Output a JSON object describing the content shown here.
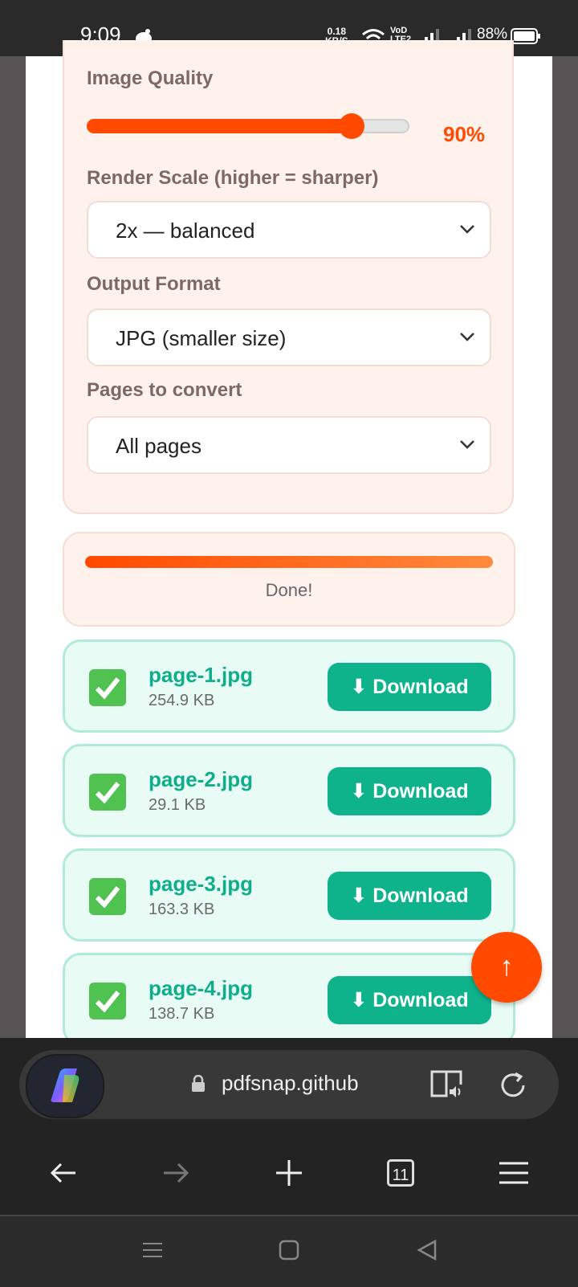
{
  "status": {
    "time": "9:09",
    "net_speed_value": "0.18",
    "net_speed_unit": "KB/S",
    "volte_top": "VoD",
    "volte_bottom": "LTE2",
    "battery": "88%"
  },
  "settings": {
    "quality_label": "Image Quality",
    "quality_value": "90%",
    "quality_fraction": 0.82,
    "scale_label": "Render Scale (higher = sharper)",
    "scale_selected": "2x — balanced",
    "format_label": "Output Format",
    "format_selected": "JPG (smaller size)",
    "pages_label": "Pages to convert",
    "pages_selected": "All pages"
  },
  "progress": {
    "status": "Done!",
    "fraction": 1.0
  },
  "files": [
    {
      "name": "page-1.jpg",
      "size": "254.9 KB",
      "button": "⬇ Download"
    },
    {
      "name": "page-2.jpg",
      "size": "29.1 KB",
      "button": "⬇ Download"
    },
    {
      "name": "page-3.jpg",
      "size": "163.3 KB",
      "button": "⬇ Download"
    },
    {
      "name": "page-4.jpg",
      "size": "138.7 KB",
      "button": "⬇ Download"
    }
  ],
  "scroll_top": "↑",
  "browser": {
    "url": "pdfsnap.github",
    "tab_count": "11"
  },
  "colors": {
    "accent": "#ff4a00",
    "success": "#0eb38c"
  }
}
